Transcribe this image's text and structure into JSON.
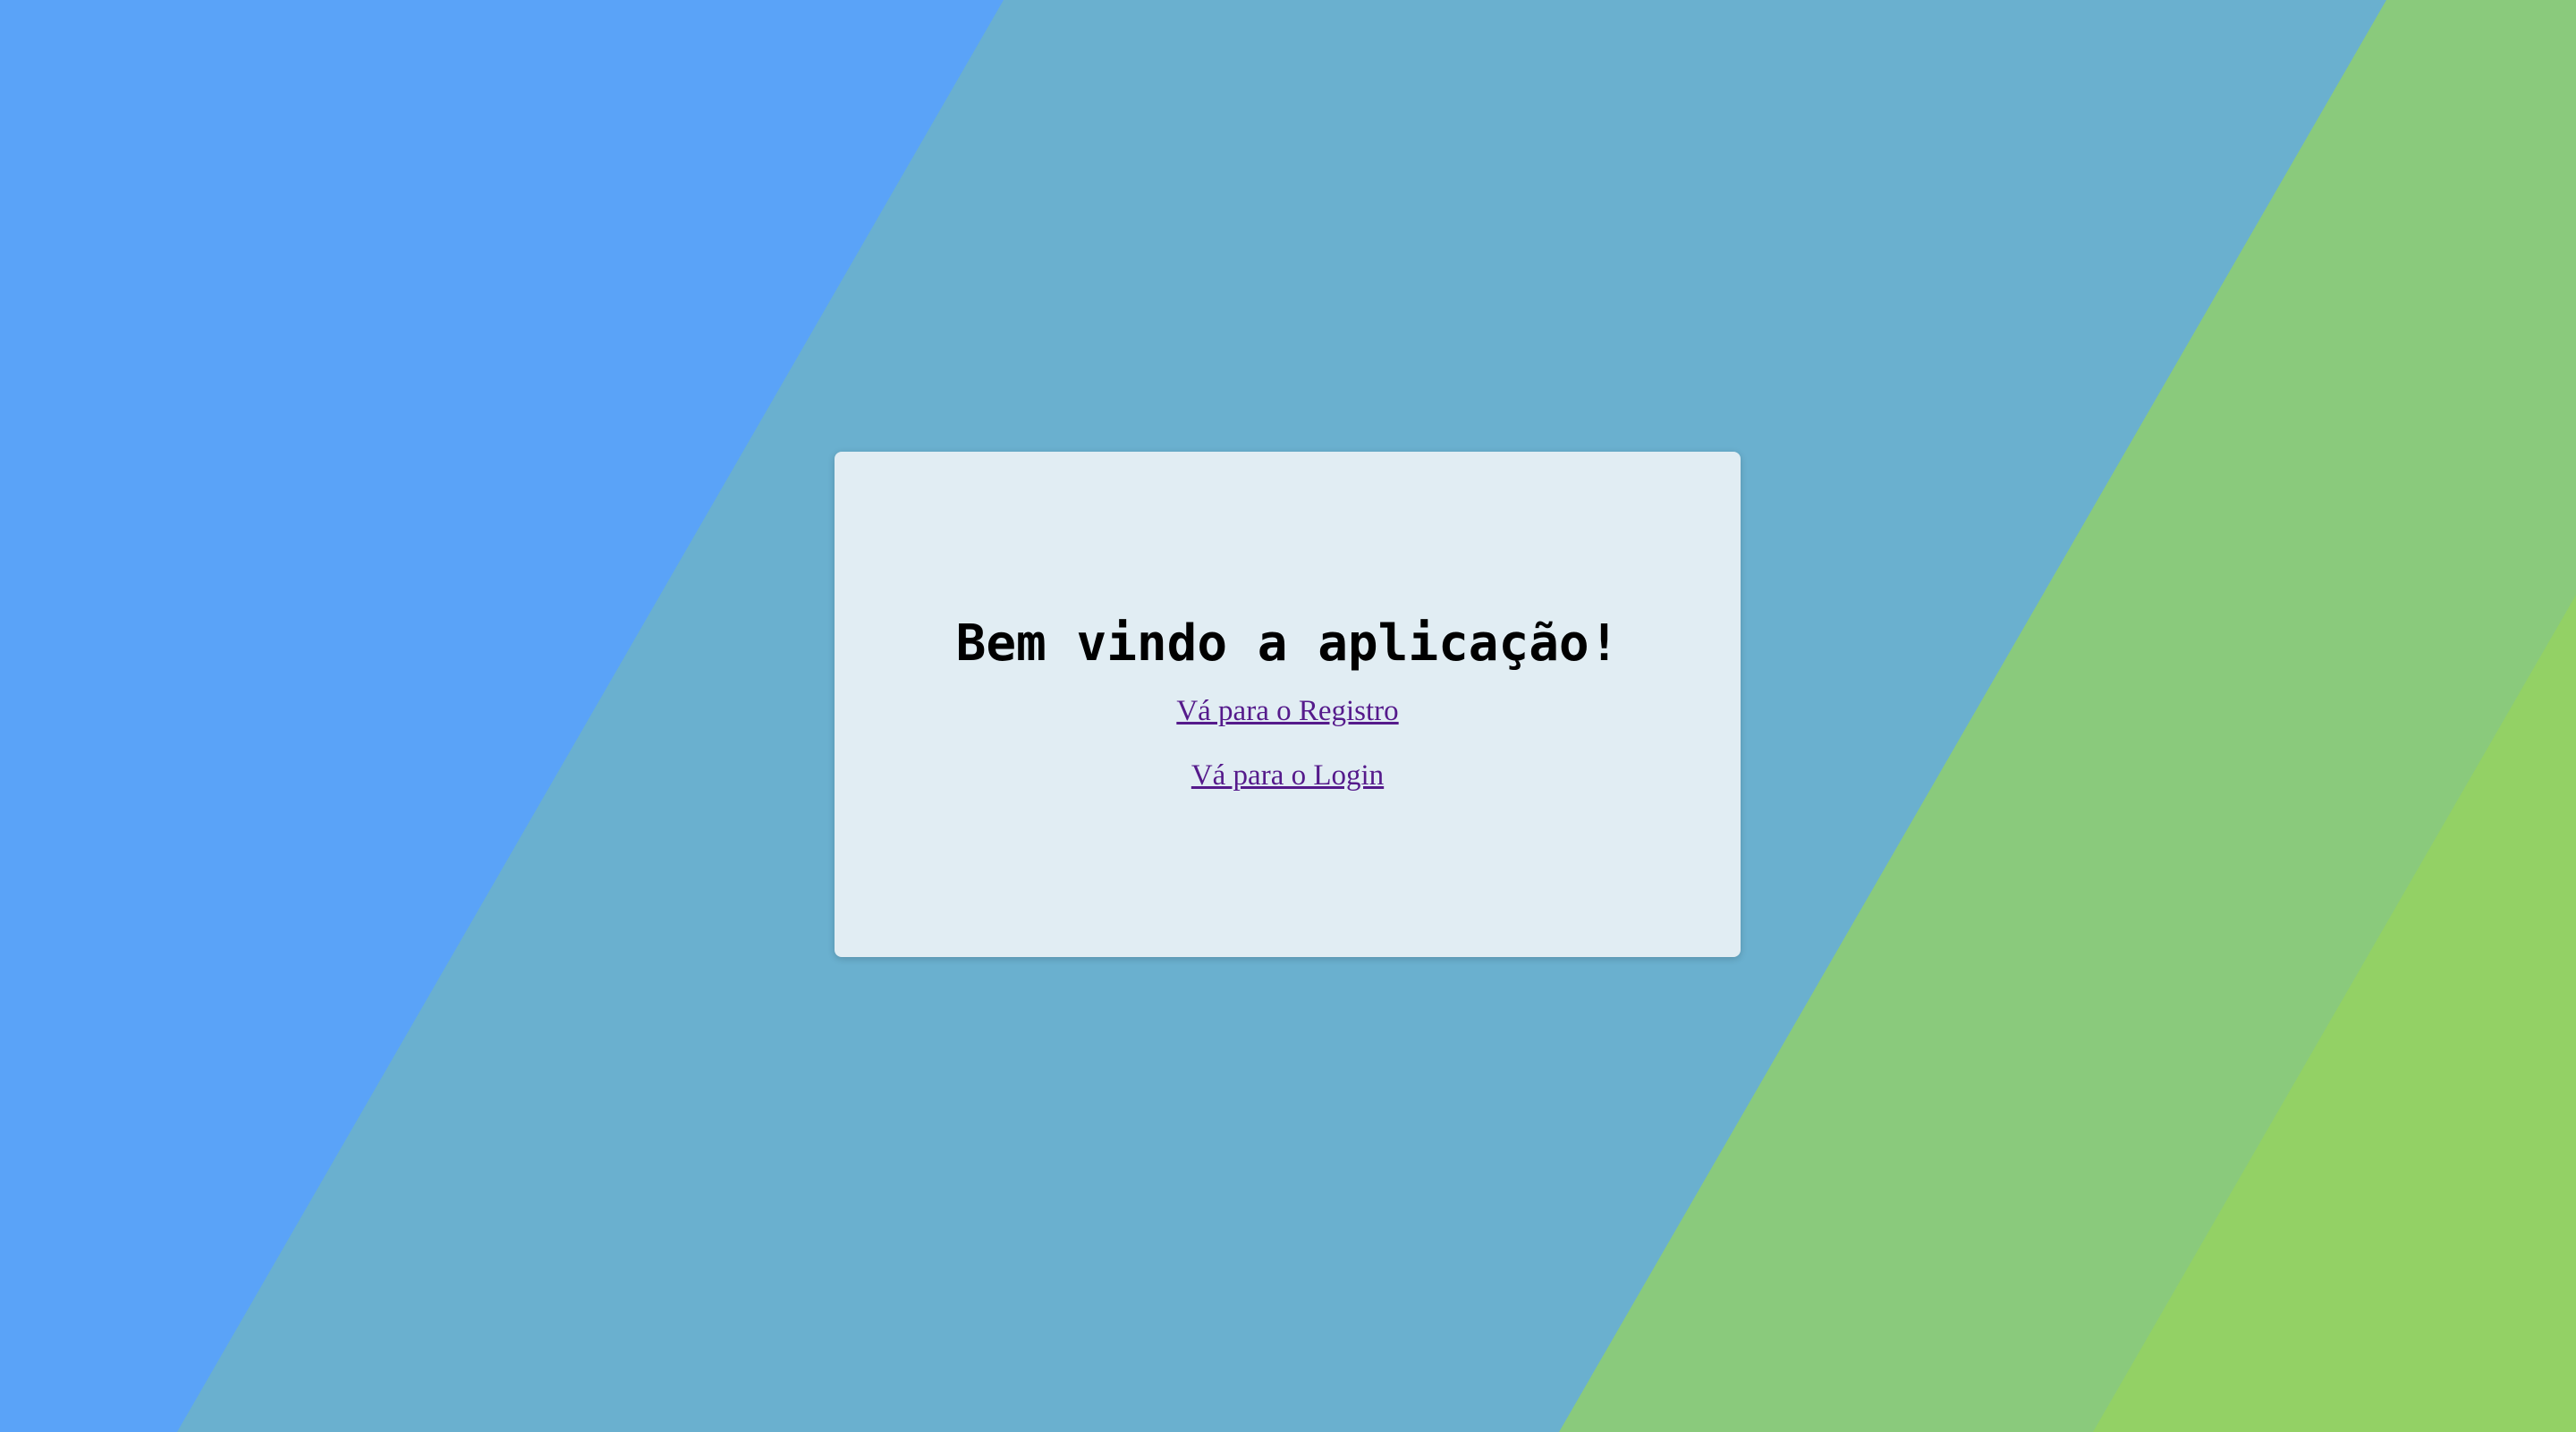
{
  "colors": {
    "band_blue": "#5aa3f8",
    "band_teal": "#6ab0cf",
    "band_green": "#8aca7c",
    "band_lime": "#93d165",
    "card_background": "#e1edf3",
    "link": "#551a8b"
  },
  "card": {
    "title": "Bem vindo a aplicação!",
    "links": [
      {
        "label": "Vá para o Registro"
      },
      {
        "label": "Vá para o Login"
      }
    ]
  }
}
